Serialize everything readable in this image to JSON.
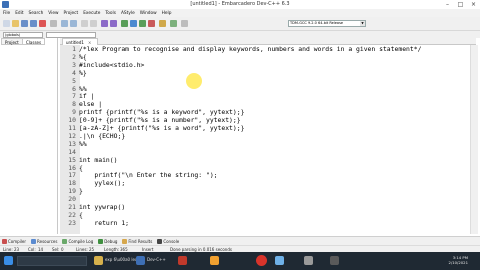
{
  "window": {
    "title": "[untitled1] - Embarcadero Dev-C++ 6.3"
  },
  "menu": [
    "File",
    "Edit",
    "Search",
    "View",
    "Project",
    "Execute",
    "Tools",
    "AStyle",
    "Window",
    "Help"
  ],
  "toolbar": {
    "compiler": "TDM-GCC 9.2.0 64-bit Release"
  },
  "scope": {
    "global": "(globals)"
  },
  "left_panel": {
    "tabs": [
      "Project",
      "Classes"
    ]
  },
  "editor": {
    "tab_label": "untitled1",
    "tab_close": "×",
    "lines": [
      {
        "n": "1",
        "text": "/*lex Program to recognise and display keywords, numbers and words in a given statement*/"
      },
      {
        "n": "2",
        "text": "%{"
      },
      {
        "n": "3",
        "text": "#include<stdio.h>"
      },
      {
        "n": "4",
        "text": "%}"
      },
      {
        "n": "5",
        "text": ""
      },
      {
        "n": "6",
        "text": "%%"
      },
      {
        "n": "7",
        "text": "if |"
      },
      {
        "n": "8",
        "text": "else |"
      },
      {
        "n": "9",
        "text": "printf {printf(\"%s is a keyword\", yytext);}"
      },
      {
        "n": "10",
        "text": "[0-9]+ {printf(\"%s is a number\", yytext);}"
      },
      {
        "n": "11",
        "text": "[a-zA-Z]+ {printf(\"%s is a word\", yytext);}"
      },
      {
        "n": "12",
        "text": ".|\\n {ECHO;}"
      },
      {
        "n": "13",
        "text": "%%"
      },
      {
        "n": "14",
        "text": ""
      },
      {
        "n": "15",
        "text": "int main()"
      },
      {
        "n": "16",
        "text": "{"
      },
      {
        "n": "17",
        "text": "    printf(\"\\n Enter the string: \");"
      },
      {
        "n": "18",
        "text": "    yylex();"
      },
      {
        "n": "19",
        "text": "}"
      },
      {
        "n": "20",
        "text": ""
      },
      {
        "n": "21",
        "text": "int yywrap()"
      },
      {
        "n": "22",
        "text": "{"
      },
      {
        "n": "23",
        "text": "    return 1;"
      }
    ]
  },
  "bottom_tabs": [
    "Compiler",
    "Resources",
    "Compile Log",
    "Debug",
    "Find Results",
    "Console"
  ],
  "status": {
    "line_label": "Line:",
    "line": "23",
    "col_label": "Col:",
    "col": "14",
    "sel_label": "Sel:",
    "sel": "0",
    "lines_label": "Lines:",
    "lines": "25",
    "length_label": "Length:",
    "length": "365",
    "mode": "Insert",
    "message": "Done parsing in 0.016 seconds"
  },
  "taskbar": {
    "apps": [
      "exp 6\\u00a0 lex",
      "Dev-C++",
      "",
      "",
      ""
    ],
    "time": "3:14 PM",
    "date": "2/10/2021"
  },
  "colors": {
    "taskbar": "#1f2933",
    "highlight": "#ffe63c",
    "accent": "#3b6fb6"
  }
}
